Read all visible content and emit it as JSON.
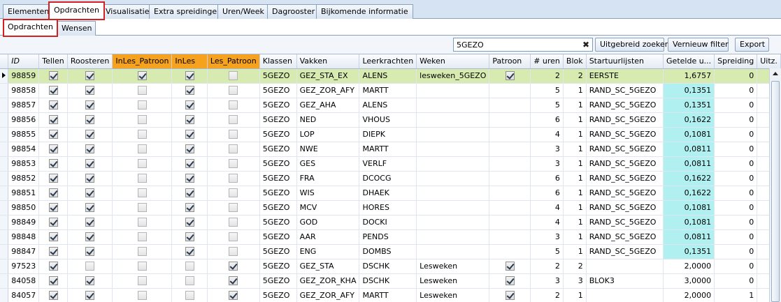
{
  "tabs_main": [
    {
      "label": "Elementen"
    },
    {
      "label": "Opdrachten"
    },
    {
      "label": "Visualisatie"
    },
    {
      "label": "Extra spreidingen"
    },
    {
      "label": "Uren/Week"
    },
    {
      "label": "Dagrooster"
    },
    {
      "label": "Bijkomende informatie"
    }
  ],
  "tabs_sub": [
    {
      "label": "Opdrachten"
    },
    {
      "label": "Wensen"
    }
  ],
  "toolbar": {
    "search_value": "5GEZO",
    "clear_label": "✖",
    "advanced_search_label": "Uitgebreid zoeken",
    "refresh_filter_label": "Vernieuw filter",
    "export_label": "Export"
  },
  "grid": {
    "headers": {
      "id": "ID",
      "tellen": "Tellen",
      "roosteren": "Roosteren",
      "inles_patroon": "InLes_Patroon",
      "inles": "InLes",
      "les_patroon": "Les_Patroon",
      "klassen": "Klassen",
      "vakken": "Vakken",
      "leerkrachten": "Leerkrachten",
      "weken": "Weken",
      "patroon": "Patroon",
      "uren": "# uren",
      "blok": "Blok",
      "startuurlijsten": "Startuurlijsten",
      "getelde": "Getelde u...",
      "spreiding": "Spreiding",
      "uitz": "Uitz."
    },
    "colors": {
      "selected_row": "#d7ebb1",
      "highlight_cell": "#b0f0f0",
      "orange_header": "#f6a21e"
    },
    "rows": [
      {
        "id": "98859",
        "tellen": true,
        "roosteren": true,
        "inles_patroon": true,
        "inles": true,
        "les_patroon": false,
        "klassen": "5GEZO",
        "vakken": "GEZ_STA_EX",
        "leerkrachten": "ALENS",
        "weken": "lesweken_5GEZO",
        "patroon": true,
        "uren": "2",
        "blok": "2",
        "startuurlijsten": "EERSTE",
        "getelde": "1,6757",
        "spreiding": "0",
        "uitz": "",
        "selected": true,
        "cyan": false
      },
      {
        "id": "98858",
        "tellen": true,
        "roosteren": true,
        "inles_patroon": false,
        "inles": true,
        "les_patroon": false,
        "klassen": "5GEZO",
        "vakken": "GEZ_ZOR_AFY",
        "leerkrachten": "MARTT",
        "weken": "",
        "patroon": null,
        "uren": "5",
        "blok": "1",
        "startuurlijsten": "RAND_SC_5GEZO",
        "getelde": "0,1351",
        "spreiding": "0",
        "uitz": "",
        "selected": false,
        "cyan": true
      },
      {
        "id": "98857",
        "tellen": true,
        "roosteren": true,
        "inles_patroon": false,
        "inles": true,
        "les_patroon": false,
        "klassen": "5GEZO",
        "vakken": "GEZ_AHA",
        "leerkrachten": "ALENS",
        "weken": "",
        "patroon": null,
        "uren": "5",
        "blok": "1",
        "startuurlijsten": "RAND_SC_5GEZO",
        "getelde": "0,1351",
        "spreiding": "0",
        "uitz": "",
        "selected": false,
        "cyan": true
      },
      {
        "id": "98856",
        "tellen": true,
        "roosteren": true,
        "inles_patroon": false,
        "inles": true,
        "les_patroon": false,
        "klassen": "5GEZO",
        "vakken": "NED",
        "leerkrachten": "VHOUS",
        "weken": "",
        "patroon": null,
        "uren": "6",
        "blok": "1",
        "startuurlijsten": "RAND_SC_5GEZO",
        "getelde": "0,1622",
        "spreiding": "0",
        "uitz": "",
        "selected": false,
        "cyan": true
      },
      {
        "id": "98855",
        "tellen": true,
        "roosteren": true,
        "inles_patroon": false,
        "inles": true,
        "les_patroon": false,
        "klassen": "5GEZO",
        "vakken": "LOP",
        "leerkrachten": "DIEPK",
        "weken": "",
        "patroon": null,
        "uren": "4",
        "blok": "1",
        "startuurlijsten": "RAND_SC_5GEZO",
        "getelde": "0,1081",
        "spreiding": "0",
        "uitz": "",
        "selected": false,
        "cyan": true
      },
      {
        "id": "98854",
        "tellen": true,
        "roosteren": true,
        "inles_patroon": false,
        "inles": true,
        "les_patroon": false,
        "klassen": "5GEZO",
        "vakken": "NWE",
        "leerkrachten": "MARTT",
        "weken": "",
        "patroon": null,
        "uren": "3",
        "blok": "1",
        "startuurlijsten": "RAND_SC_5GEZO",
        "getelde": "0,0811",
        "spreiding": "0",
        "uitz": "",
        "selected": false,
        "cyan": true
      },
      {
        "id": "98853",
        "tellen": true,
        "roosteren": true,
        "inles_patroon": false,
        "inles": true,
        "les_patroon": false,
        "klassen": "5GEZO",
        "vakken": "GES",
        "leerkrachten": "VERLF",
        "weken": "",
        "patroon": null,
        "uren": "3",
        "blok": "1",
        "startuurlijsten": "RAND_SC_5GEZO",
        "getelde": "0,0811",
        "spreiding": "0",
        "uitz": "",
        "selected": false,
        "cyan": true
      },
      {
        "id": "98852",
        "tellen": true,
        "roosteren": true,
        "inles_patroon": false,
        "inles": true,
        "les_patroon": false,
        "klassen": "5GEZO",
        "vakken": "FRA",
        "leerkrachten": "DCOCG",
        "weken": "",
        "patroon": null,
        "uren": "6",
        "blok": "1",
        "startuurlijsten": "RAND_SC_5GEZO",
        "getelde": "0,1622",
        "spreiding": "0",
        "uitz": "",
        "selected": false,
        "cyan": true
      },
      {
        "id": "98851",
        "tellen": true,
        "roosteren": true,
        "inles_patroon": false,
        "inles": true,
        "les_patroon": false,
        "klassen": "5GEZO",
        "vakken": "WIS",
        "leerkrachten": "DHAEK",
        "weken": "",
        "patroon": null,
        "uren": "6",
        "blok": "1",
        "startuurlijsten": "RAND_SC_5GEZO",
        "getelde": "0,1622",
        "spreiding": "0",
        "uitz": "",
        "selected": false,
        "cyan": true
      },
      {
        "id": "98850",
        "tellen": true,
        "roosteren": true,
        "inles_patroon": false,
        "inles": true,
        "les_patroon": false,
        "klassen": "5GEZO",
        "vakken": "MCV",
        "leerkrachten": "HORES",
        "weken": "",
        "patroon": null,
        "uren": "4",
        "blok": "1",
        "startuurlijsten": "RAND_SC_5GEZO",
        "getelde": "0,1081",
        "spreiding": "0",
        "uitz": "",
        "selected": false,
        "cyan": true
      },
      {
        "id": "98849",
        "tellen": true,
        "roosteren": true,
        "inles_patroon": false,
        "inles": true,
        "les_patroon": false,
        "klassen": "5GEZO",
        "vakken": "GOD",
        "leerkrachten": "DOCKI",
        "weken": "",
        "patroon": null,
        "uren": "4",
        "blok": "1",
        "startuurlijsten": "RAND_SC_5GEZO",
        "getelde": "0,1081",
        "spreiding": "0",
        "uitz": "",
        "selected": false,
        "cyan": true
      },
      {
        "id": "98848",
        "tellen": true,
        "roosteren": true,
        "inles_patroon": false,
        "inles": true,
        "les_patroon": false,
        "klassen": "5GEZO",
        "vakken": "AAR",
        "leerkrachten": "PENDS",
        "weken": "",
        "patroon": null,
        "uren": "3",
        "blok": "1",
        "startuurlijsten": "RAND_SC_5GEZO",
        "getelde": "0,0811",
        "spreiding": "0",
        "uitz": "",
        "selected": false,
        "cyan": true
      },
      {
        "id": "98847",
        "tellen": true,
        "roosteren": true,
        "inles_patroon": false,
        "inles": true,
        "les_patroon": false,
        "klassen": "5GEZO",
        "vakken": "ENG",
        "leerkrachten": "DOMBS",
        "weken": "",
        "patroon": null,
        "uren": "5",
        "blok": "1",
        "startuurlijsten": "RAND_SC_5GEZO",
        "getelde": "0,1351",
        "spreiding": "0",
        "uitz": "",
        "selected": false,
        "cyan": true
      },
      {
        "id": "97523",
        "tellen": true,
        "roosteren": false,
        "inles_patroon": false,
        "inles": false,
        "les_patroon": true,
        "klassen": "5GEZO",
        "vakken": "GEZ_STA",
        "leerkrachten": "DSCHK",
        "weken": "Lesweken",
        "patroon": true,
        "uren": "2",
        "blok": "2",
        "startuurlijsten": "",
        "getelde": "2,0000",
        "spreiding": "0",
        "uitz": "",
        "selected": false,
        "cyan": false
      },
      {
        "id": "84058",
        "tellen": true,
        "roosteren": true,
        "inles_patroon": false,
        "inles": false,
        "les_patroon": true,
        "klassen": "5GEZO",
        "vakken": "GEZ_ZOR_KHA",
        "leerkrachten": "DSCHK",
        "weken": "Lesweken",
        "patroon": true,
        "uren": "3",
        "blok": "3",
        "startuurlijsten": "BLOK3",
        "getelde": "3,0000",
        "spreiding": "0",
        "uitz": "",
        "selected": false,
        "cyan": false
      },
      {
        "id": "84057",
        "tellen": true,
        "roosteren": true,
        "inles_patroon": false,
        "inles": false,
        "les_patroon": true,
        "klassen": "5GEZO",
        "vakken": "GEZ_ZOR_AFY",
        "leerkrachten": "MARTT",
        "weken": "Lesweken",
        "patroon": true,
        "uren": "2",
        "blok": "1",
        "startuurlijsten": "",
        "getelde": "2,0000",
        "spreiding": "1",
        "uitz": "",
        "selected": false,
        "cyan": false
      }
    ]
  }
}
